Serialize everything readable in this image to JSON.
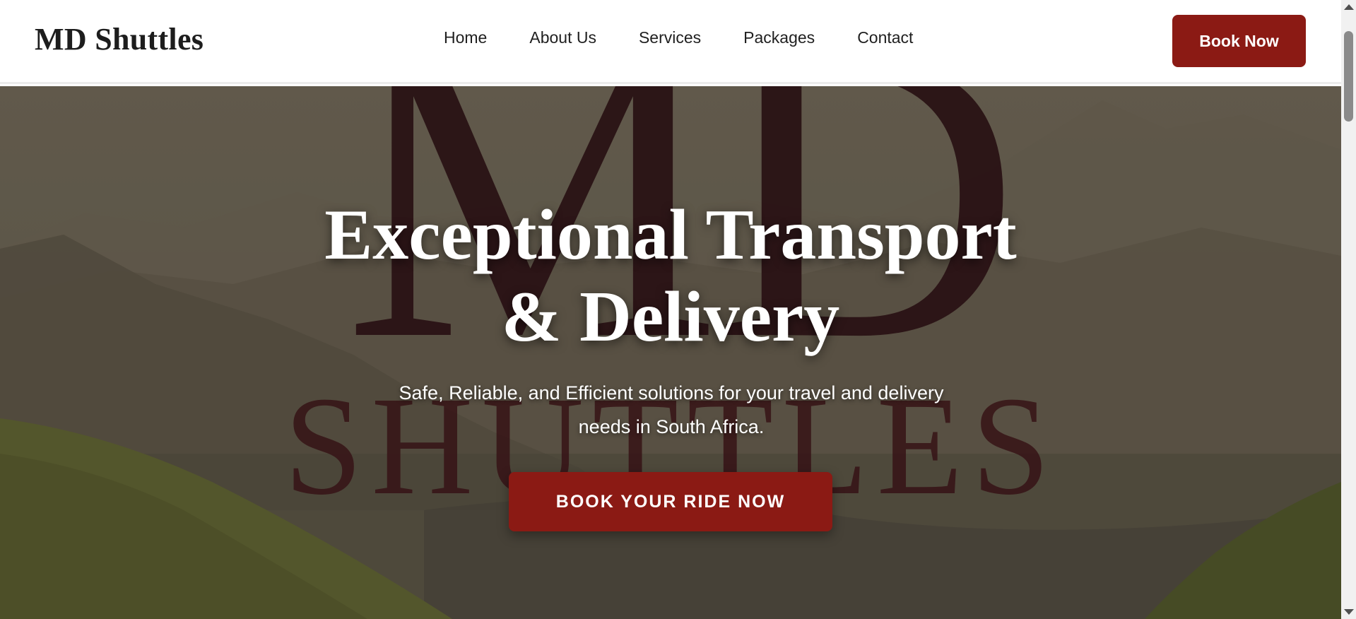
{
  "header": {
    "logo": "MD Shuttles",
    "nav": [
      "Home",
      "About Us",
      "Services",
      "Packages",
      "Contact"
    ],
    "book_label": "Book Now"
  },
  "hero": {
    "watermark_top": "MD",
    "watermark_bottom": "SHUTTLES",
    "title_line1": "Exceptional Transport",
    "title_line2": "& Delivery",
    "subtitle_line1": "Safe, Reliable, and Efficient solutions for your travel and delivery",
    "subtitle_line2": "needs in South Africa.",
    "cta_label": "BOOK YOUR RIDE NOW"
  },
  "colors": {
    "brand": "#8b1a14",
    "text_dark": "#1d1d1d"
  }
}
